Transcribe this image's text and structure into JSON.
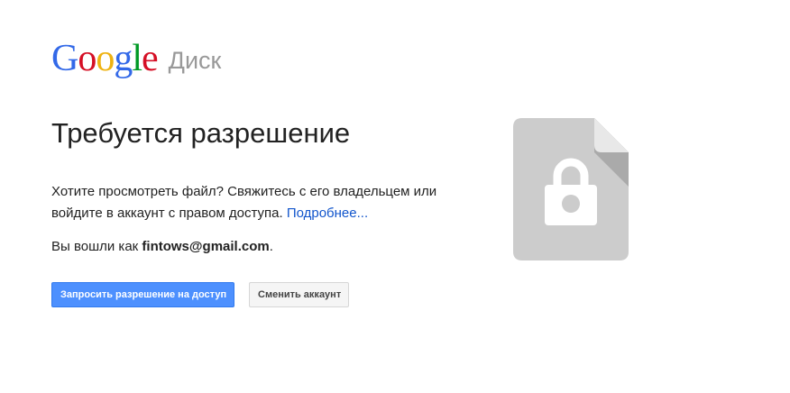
{
  "header": {
    "logo_letters": [
      {
        "char": "G",
        "color": "#3369e8"
      },
      {
        "char": "o",
        "color": "#d50f25"
      },
      {
        "char": "o",
        "color": "#eeb211"
      },
      {
        "char": "g",
        "color": "#3369e8"
      },
      {
        "char": "l",
        "color": "#009925"
      },
      {
        "char": "e",
        "color": "#d50f25"
      }
    ],
    "product_name": "Диск"
  },
  "main": {
    "title": "Требуется разрешение",
    "description": "Хотите просмотреть файл? Свяжитесь с его владельцем или войдите в аккаунт с правом доступа.",
    "learn_more_label": "Подробнее...",
    "signed_in_prefix": "Вы вошли как",
    "signed_in_email": "fintows@gmail.com",
    "signed_in_suffix": "."
  },
  "buttons": {
    "request_access_label": "Запросить разрешение на доступ",
    "switch_account_label": "Сменить аккаунт"
  },
  "icon": {
    "name": "locked-file-icon",
    "color": "#cccccc"
  },
  "colors": {
    "primary_button": "#4d90fe",
    "link": "#1155cc"
  }
}
